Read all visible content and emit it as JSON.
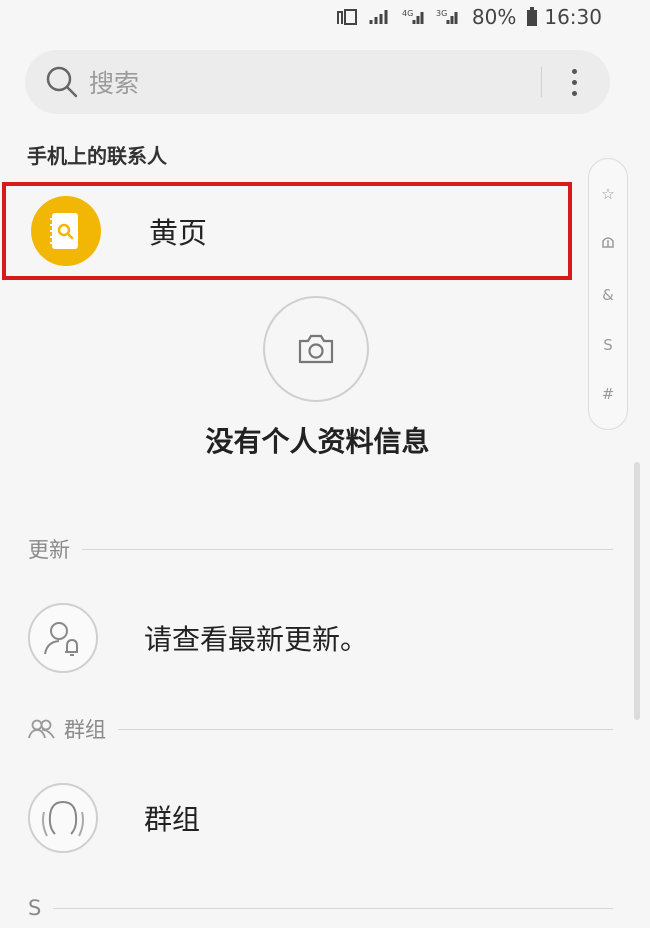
{
  "status_bar": {
    "battery_percent": "80%",
    "time": "16:30"
  },
  "search": {
    "placeholder": "搜索"
  },
  "contacts": {
    "section_phone": "手机上的联系人",
    "yellow_pages": "黄页"
  },
  "index_bar": {
    "items": [
      "☆",
      "",
      "&",
      "S",
      "#"
    ]
  },
  "profile": {
    "empty_text": "没有个人资料信息"
  },
  "updates": {
    "header": "更新",
    "item": "请查看最新更新。"
  },
  "groups": {
    "header": "群组",
    "item": "群组"
  },
  "s_section": {
    "header": "S"
  },
  "colors": {
    "highlight": "#d71a1a",
    "yellow_avatar": "#f2b705",
    "background": "#f6f6f6"
  }
}
